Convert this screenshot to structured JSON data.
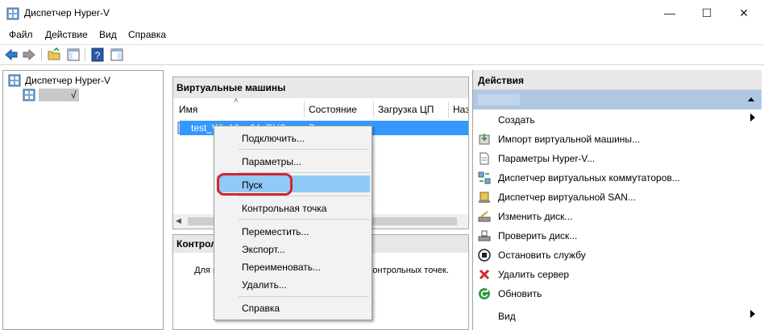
{
  "window": {
    "title": "Диспетчер Hyper-V",
    "minimize_glyph": "—",
    "maximize_glyph": "☐",
    "close_glyph": "✕"
  },
  "menu": [
    "Файл",
    "Действие",
    "Вид",
    "Справка"
  ],
  "tree": {
    "root_label": "Диспетчер Hyper-V",
    "host_suffix": "√"
  },
  "vm_panel": {
    "header": "Виртуальные машины",
    "sort_glyph": "˄",
    "columns": [
      "Имя",
      "Состояние",
      "Загрузка ЦП",
      "Назн"
    ],
    "row": {
      "name": "test_Win10_x64_RUS",
      "state": "Выключена"
    }
  },
  "ctrl_panel": {
    "header": "Контрольные точки",
    "message": "Для выбранной виртуальной машины нет контрольных точек."
  },
  "actions": {
    "header": "Действия",
    "items": [
      {
        "label": "Создать",
        "icon": "blank",
        "submenu": true
      },
      {
        "label": "Импорт виртуальной машины...",
        "icon": "import-icon",
        "submenu": false
      },
      {
        "label": "Параметры Hyper-V...",
        "icon": "settings-page-icon",
        "submenu": false
      },
      {
        "label": "Диспетчер виртуальных коммутаторов...",
        "icon": "switch-manager-icon",
        "submenu": false
      },
      {
        "label": "Диспетчер виртуальной SAN...",
        "icon": "san-manager-icon",
        "submenu": false
      },
      {
        "label": "Изменить диск...",
        "icon": "edit-disk-icon",
        "submenu": false
      },
      {
        "label": "Проверить диск...",
        "icon": "inspect-disk-icon",
        "submenu": false
      },
      {
        "label": "Остановить службу",
        "icon": "stop-service-icon",
        "submenu": false
      },
      {
        "label": "Удалить сервер",
        "icon": "remove-server-icon",
        "submenu": false
      },
      {
        "label": "Обновить",
        "icon": "refresh-icon",
        "submenu": false
      },
      {
        "label": "Вид",
        "icon": "blank",
        "submenu": true
      }
    ]
  },
  "context_menu": {
    "connect": "Подключить...",
    "settings": "Параметры...",
    "start": "Пуск",
    "checkpoint": "Контрольная точка",
    "move": "Переместить...",
    "export": "Экспорт...",
    "rename": "Переименовать...",
    "delete": "Удалить...",
    "help": "Справка"
  },
  "colors": {
    "selection": "#3399ff",
    "menu_highlight": "#91c9f7",
    "annotation_circle": "#d0262e",
    "actions_subheader": "#aec8e4"
  }
}
